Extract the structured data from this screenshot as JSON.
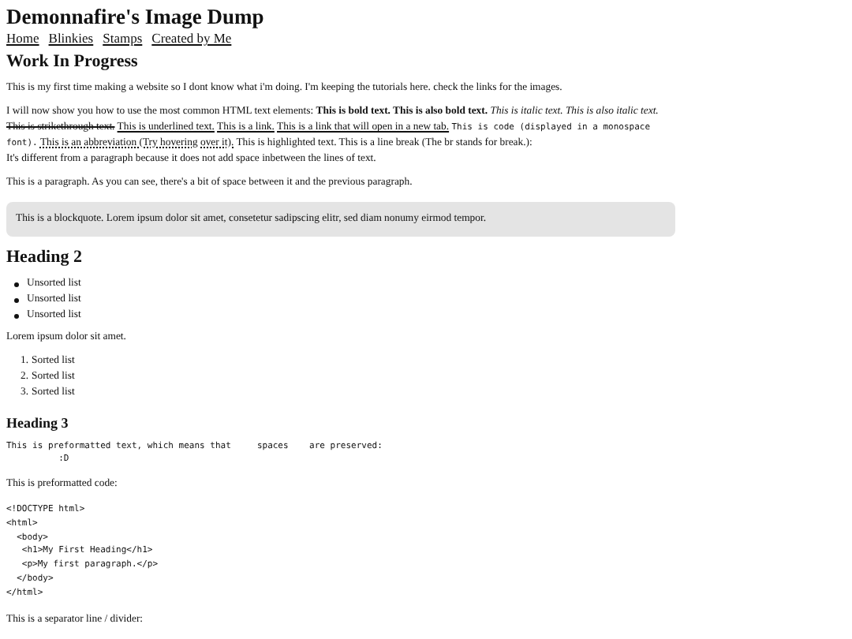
{
  "site_title": "Demonnafire's Image Dump",
  "nav": [
    {
      "label": "Home"
    },
    {
      "label": "Blinkies"
    },
    {
      "label": "Stamps"
    },
    {
      "label": "Created by Me"
    }
  ],
  "heading_1": "Work In Progress",
  "intro": "This is my first time making a website so I dont know what i'm doing. I'm keeping the tutorials here. check the links for the images.",
  "elements_paragraph": [
    {
      "kind": "plain",
      "text": "I will now show you how to use the most common HTML text elements:"
    },
    {
      "kind": "bold",
      "text": "This is bold text. This is also bold text."
    },
    {
      "kind": "italic",
      "text": "This is italic text. This is also italic text."
    },
    {
      "kind": "strike",
      "text": "This is strikethrough text."
    },
    {
      "kind": "underline",
      "text": "This is underlined text."
    },
    {
      "kind": "link",
      "text": "This is a link."
    },
    {
      "kind": "link",
      "text": "This is a link that will open in a new tab."
    },
    {
      "kind": "code",
      "text": "This is code (displayed in a monospace font)."
    },
    {
      "kind": "abbr",
      "text": "This is an abbreviation (Try hovering over it)."
    },
    {
      "kind": "plain",
      "text": "This is highlighted text. This is a line break (The br stands for break.):"
    },
    {
      "kind": "newline",
      "text": "It's different from a paragraph because it does not add space inbetween the lines of text."
    }
  ],
  "paragraph": "This is a paragraph. As you can see, there's a bit of space between it and the previous paragraph.",
  "blockquote": "This is a blockquote. Lorem ipsum dolor sit amet, consetetur sadipscing elitr, sed diam nonumy eirmod tempor.",
  "heading_2": "Heading 2",
  "unsorted_list": [
    "Unsorted list",
    "Unsorted list",
    "Unsorted list"
  ],
  "lorem": "Lorem ipsum dolor sit amet.",
  "sorted_list": [
    {
      "number": "1.",
      "text": "Sorted list"
    },
    {
      "number": "2.",
      "text": "Sorted list"
    },
    {
      "number": "3.",
      "text": "Sorted list"
    }
  ],
  "heading_3": "Heading 3",
  "preformatted_text": "This is preformatted text, which means that     spaces    are preserved:\n          :D",
  "code_caption": "This is preformatted code:",
  "code_block": "<!DOCTYPE html>\n<html>\n  <body>\n   <h1>My First Heading</h1>\n   <p>My first paragraph.</p>\n  </body>\n</html>",
  "separator_caption": "This is a separator line / divider:"
}
